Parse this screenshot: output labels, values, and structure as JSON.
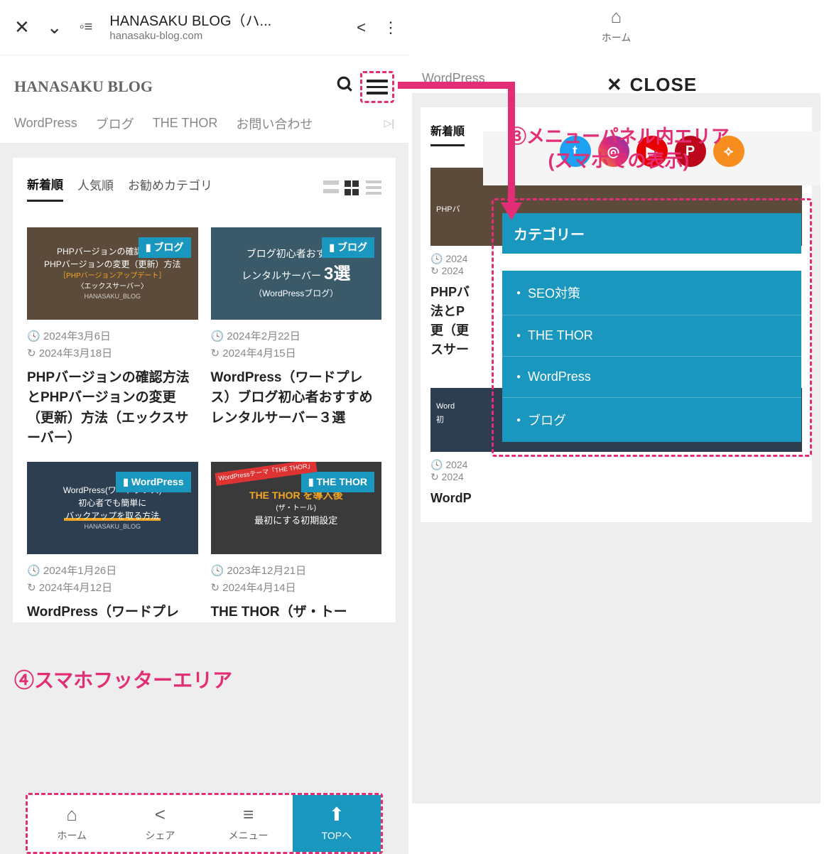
{
  "browser": {
    "title": "HANASAKU BLOG（ハ...",
    "url": "hanasaku-blog.com"
  },
  "site": {
    "logo": "HANASAKU BLOG"
  },
  "nav": [
    "WordPress",
    "ブログ",
    "THE THOR",
    "お問い合わせ"
  ],
  "tabs": {
    "newest": "新着順",
    "popular": "人気順",
    "recommend": "お勧めカテゴリ"
  },
  "posts": [
    {
      "cat": "ブログ",
      "thumb_lines": [
        "PHPバージョンの確認方法と",
        "PHPバージョンの変更（更新）方法",
        "［PHPバージョンアップデート］",
        "〈エックスサーバー〉"
      ],
      "blog_footer": "HANASAKU_BLOG",
      "date1": "2024年3月6日",
      "date2": "2024年3月18日",
      "title": "PHPバージョンの確認方法とPHPバージョンの変更（更新）方法（エックスサーバー）"
    },
    {
      "cat": "ブログ",
      "thumb_lines": [
        "ブログ初心者おすすめ",
        "レンタルサーバー",
        "（WordPressブログ）"
      ],
      "big": "3選",
      "date1": "2024年2月22日",
      "date2": "2024年4月15日",
      "title": "WordPress（ワードプレス）ブログ初心者おすすめレンタルサーバー３選"
    },
    {
      "cat": "WordPress",
      "thumb_lines": [
        "WordPress(ワードプレス)",
        "初心者でも簡単に",
        "バックアップを取る方法"
      ],
      "blog_footer": "HANASAKU_BLOG",
      "date1": "2024年1月26日",
      "date2": "2024年4月12日",
      "title": "WordPress（ワードプレ"
    },
    {
      "cat": "THE THOR",
      "thumb_lines": [
        "WordPressテーマ「THE THOR」",
        "THE THOR を導入後",
        "最初にする初期設定"
      ],
      "sub": "(ザ・トール)",
      "date1": "2023年12月21日",
      "date2": "2024年4月14日",
      "title": "THE THOR（ザ・トー"
    }
  ],
  "footer": {
    "home": "ホーム",
    "share": "シェア",
    "menu": "メニュー",
    "top": "TOPへ"
  },
  "panel": {
    "close": "CLOSE",
    "cat_header": "カテゴリー",
    "cats": [
      "SEO対策",
      "THE THOR",
      "WordPress",
      "ブログ"
    ]
  },
  "annotations": {
    "a3_l1": "③メニューパネル内エリア",
    "a3_l2": "(スマホでの表示)",
    "a4": "④スマホフッターエリア"
  },
  "behind": {
    "nav0": "WordPress",
    "tab": "新着順",
    "title1_l1": "PHPバ",
    "title1_l2": "法とP",
    "title1_l3": "更（更",
    "title1_l4": "スサー",
    "meta1": "2024",
    "meta2": "2024",
    "title2": "WordP",
    "thumb_text1": "PHPバ",
    "thumb_text2": "Word",
    "thumb_text3": "初"
  },
  "socials": [
    {
      "name": "twitter",
      "bg": "#1da1f2",
      "glyph": "t"
    },
    {
      "name": "instagram",
      "bg": "linear-gradient(45deg,#f58529,#dd2a7b,#8134af)",
      "glyph": "◎"
    },
    {
      "name": "youtube",
      "bg": "#e60000",
      "glyph": "▶"
    },
    {
      "name": "pinterest",
      "bg": "#bd081c",
      "glyph": "P"
    },
    {
      "name": "rss",
      "bg": "#f78c1f",
      "glyph": "⟡"
    }
  ]
}
